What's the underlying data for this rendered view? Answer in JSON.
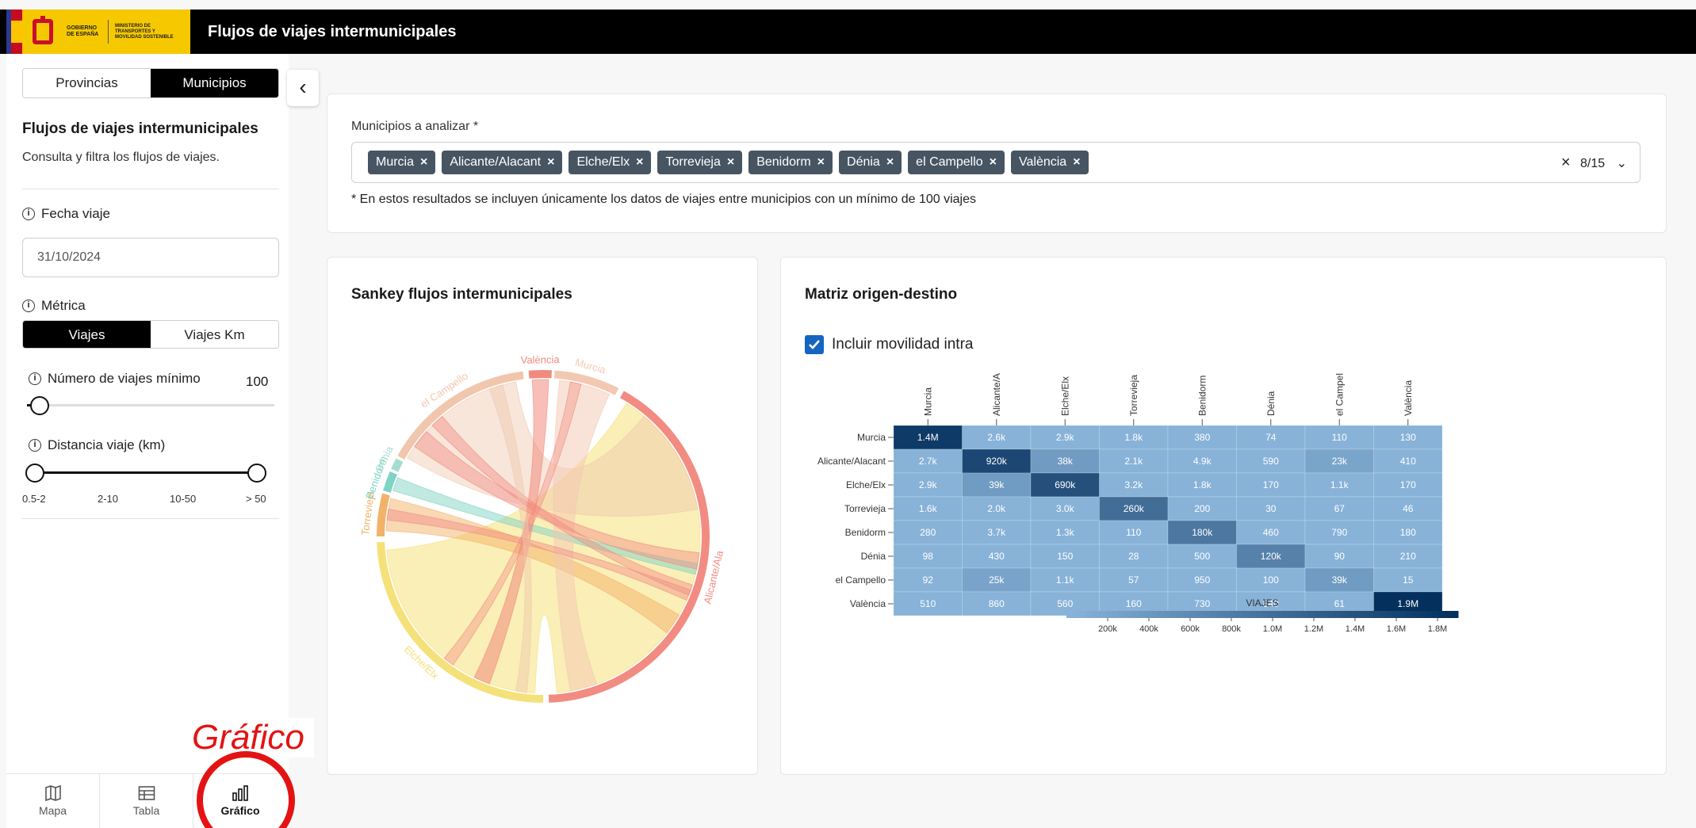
{
  "header": {
    "logo_gov": "GOBIERNO DE ESPAÑA",
    "logo_ministry": "MINISTERIO DE TRANSPORTES Y MOVILIDAD SOSTENIBLE",
    "title": "Flujos de viajes intermunicipales"
  },
  "sidebar": {
    "tabs": [
      "Provincias",
      "Municipios"
    ],
    "active_tab": "Municipios",
    "title": "Flujos de viajes intermunicipales",
    "subtitle": "Consulta y filtra los flujos de viajes.",
    "date_label": "Fecha viaje",
    "date_value": "31/10/2024",
    "metric_label": "Métrica",
    "metric_options": [
      "Viajes",
      "Viajes Km"
    ],
    "metric_active": "Viajes",
    "min_trips_label": "Número de viajes mínimo",
    "min_trips_value": "100",
    "min_trips_fraction": 0.05,
    "distance_label": "Distancia viaje (km)",
    "distance_ticks": [
      "0.5-2",
      "2-10",
      "10-50",
      "> 50"
    ],
    "distance_range": [
      0,
      3
    ]
  },
  "bottom_nav": {
    "items": [
      "Mapa",
      "Tabla",
      "Gráfico"
    ],
    "active": "Gráfico"
  },
  "annotation": "Gráfico",
  "filter": {
    "label": "Municipios a analizar *",
    "selected": [
      "Murcia",
      "Alicante/Alacant",
      "Elche/Elx",
      "Torrevieja",
      "Benidorm",
      "Dénia",
      "el Campello",
      "València"
    ],
    "count": "8/15",
    "note": "* En estos resultados se incluyen únicamente los datos de viajes entre municipios con un mínimo de 100 viajes"
  },
  "sankey": {
    "title": "Sankey flujos intermunicipales",
    "labels": [
      "València",
      "Murcia",
      "Alicante/Ala",
      "Elche/Elx",
      "Torrevieja",
      "Benidorm",
      "Dénia",
      "el Campello"
    ],
    "colors": {
      "València": "#f08a7e",
      "Murcia": "#f3c8b2",
      "Alicante/Ala": "#f28b82",
      "Elche/Elx": "#f5e17a",
      "Torrevieja": "#f3b26a",
      "Benidorm": "#7fd3c4",
      "Dénia": "#a6dcd0",
      "el Campello": "#f0c7ad"
    }
  },
  "matrix": {
    "title": "Matriz origen-destino",
    "include_intra_label": "Incluir movilidad intra",
    "include_intra": true,
    "col_labels": [
      "Murcia",
      "Alicante/A",
      "Elche/Elx",
      "Torrevieja",
      "Benidorm",
      "Dénia",
      "el Campel",
      "València"
    ],
    "legend_title": "VIAJES",
    "legend_ticks": [
      "200k",
      "400k",
      "600k",
      "800k",
      "1.0M",
      "1.2M",
      "1.4M",
      "1.6M",
      "1.8M"
    ]
  },
  "chart_data": {
    "type": "heatmap",
    "rows": [
      "Murcia",
      "Alicante/Alacant",
      "Elche/Elx",
      "Torrevieja",
      "Benidorm",
      "Dénia",
      "el Campello",
      "València"
    ],
    "columns": [
      "Murcia",
      "Alicante/A",
      "Elche/Elx",
      "Torrevieja",
      "Benidorm",
      "Dénia",
      "el Campel",
      "València"
    ],
    "cell_labels": [
      [
        "1.4M",
        "2.6k",
        "2.9k",
        "1.8k",
        "380",
        "74",
        "110",
        "130"
      ],
      [
        "2.7k",
        "920k",
        "38k",
        "2.1k",
        "4.9k",
        "590",
        "23k",
        "410"
      ],
      [
        "2.9k",
        "39k",
        "690k",
        "3.2k",
        "1.8k",
        "170",
        "1.1k",
        "170"
      ],
      [
        "1.6k",
        "2.0k",
        "3.0k",
        "260k",
        "200",
        "30",
        "67",
        "46"
      ],
      [
        "280",
        "3.7k",
        "1.3k",
        "110",
        "180k",
        "460",
        "790",
        "180"
      ],
      [
        "98",
        "430",
        "150",
        "28",
        "500",
        "120k",
        "90",
        "210"
      ],
      [
        "92",
        "25k",
        "1.1k",
        "57",
        "950",
        "100",
        "39k",
        "15"
      ],
      [
        "510",
        "860",
        "560",
        "160",
        "730",
        "840",
        "61",
        "1.9M"
      ]
    ],
    "values": [
      [
        1400000,
        2600,
        2900,
        1800,
        380,
        74,
        110,
        130
      ],
      [
        2700,
        920000,
        38000,
        2100,
        4900,
        590,
        23000,
        410
      ],
      [
        2900,
        39000,
        690000,
        3200,
        1800,
        170,
        1100,
        170
      ],
      [
        1600,
        2000,
        3000,
        260000,
        200,
        30,
        67,
        46
      ],
      [
        280,
        3700,
        1300,
        110,
        180000,
        460,
        790,
        180
      ],
      [
        98,
        430,
        150,
        28,
        500,
        120000,
        90,
        210
      ],
      [
        92,
        25000,
        1100,
        57,
        950,
        100,
        39000,
        15
      ],
      [
        510,
        860,
        560,
        160,
        730,
        840,
        61,
        1900000
      ]
    ],
    "color_range": [
      0,
      1900000
    ]
  }
}
